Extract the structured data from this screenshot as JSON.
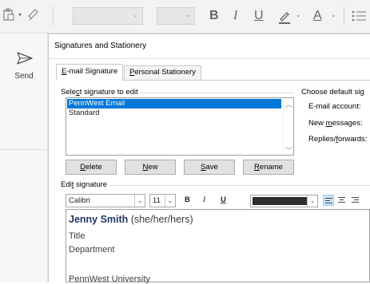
{
  "ribbon": {
    "font_name": "",
    "font_size": "",
    "bold": "B",
    "italic": "I",
    "underline": "U",
    "highlight_icon": "highlighter-icon",
    "font_color": "A"
  },
  "left_panel": {
    "send_label": "Send"
  },
  "dialog": {
    "title": "Signatures and Stationery",
    "tabs": [
      {
        "label_u": "E",
        "label_rest": "-mail Signature",
        "active": true
      },
      {
        "label_u": "P",
        "label_rest": "ersonal Stationery",
        "active": false
      }
    ],
    "select_label_pre": "Sele",
    "select_label_u": "c",
    "select_label_post": "t signature to edit",
    "signatures": [
      "PennWest Email",
      "Standard"
    ],
    "selected_index": 0,
    "buttons": {
      "delete_u": "D",
      "delete_rest": "elete",
      "new_u": "N",
      "new_rest": "ew",
      "save_u": "S",
      "save_rest": "ave",
      "rename_u": "R",
      "rename_rest": "ename"
    },
    "defaults": {
      "title": "Choose default sig",
      "email_account": "E-mail account:",
      "new_messages_pre": "New ",
      "new_messages_u": "m",
      "new_messages_post": "essages:",
      "replies_pre": "Replies/",
      "replies_u": "f",
      "replies_post": "orwards:"
    },
    "edit_label_pre": "Edi",
    "edit_label_u": "t",
    "edit_label_post": " signature",
    "toolbar": {
      "font": "Calibri",
      "size": "11",
      "bold": "B",
      "italic": "I",
      "underline": "U",
      "font_color": "#2e2e2e"
    },
    "signature": {
      "name": "Jenny Smith",
      "pronouns": " (she/her/hers)",
      "title": "Title",
      "department": "Department",
      "organization": "PennWest University"
    }
  },
  "colors": {
    "accent": "#0078d7",
    "name_color": "#1f3864"
  }
}
